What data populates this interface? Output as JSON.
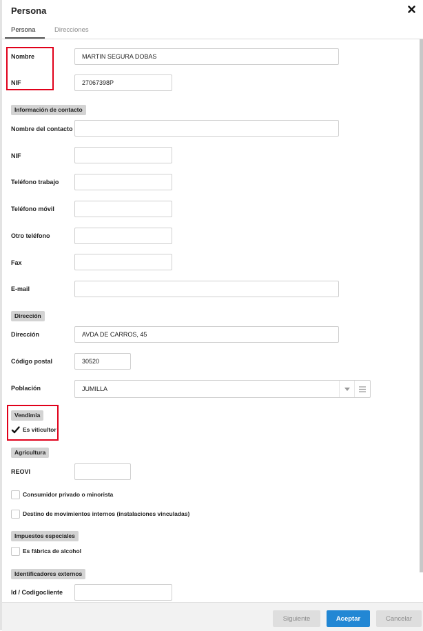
{
  "dialog": {
    "title": "Persona",
    "tabs": [
      {
        "label": "Persona",
        "active": true
      },
      {
        "label": "Direcciones",
        "active": false
      }
    ]
  },
  "main": {
    "nombre": {
      "label": "Nombre",
      "value": "MARTIN SEGURA DOBAS"
    },
    "nif": {
      "label": "NIF",
      "value": "27067398P"
    }
  },
  "contacto": {
    "section": "Información de contacto",
    "nombre_contacto": {
      "label": "Nombre del contacto",
      "value": ""
    },
    "nif": {
      "label": "NIF",
      "value": ""
    },
    "telefono_trabajo": {
      "label": "Teléfono trabajo",
      "value": ""
    },
    "telefono_movil": {
      "label": "Teléfono móvil",
      "value": ""
    },
    "otro_telefono": {
      "label": "Otro teléfono",
      "value": ""
    },
    "fax": {
      "label": "Fax",
      "value": ""
    },
    "email": {
      "label": "E-mail",
      "value": ""
    }
  },
  "direccion": {
    "section": "Dirección",
    "direccion": {
      "label": "Dirección",
      "value": "AVDA DE CARROS, 45"
    },
    "codigo_postal": {
      "label": "Código postal",
      "value": "30520"
    },
    "poblacion": {
      "label": "Población",
      "value": "JUMILLA"
    }
  },
  "vendimia": {
    "section": "Vendimia",
    "viticultor": {
      "label": "Es viticultor",
      "checked": true
    }
  },
  "agricultura": {
    "section": "Agricultura",
    "reovi": {
      "label": "REOVI",
      "value": ""
    },
    "consumidor": {
      "label": "Consumidor privado o minorista",
      "checked": false
    },
    "destino": {
      "label": "Destino de movimientos internos (instalaciones vinculadas)",
      "checked": false
    }
  },
  "impuestos": {
    "section": "Impuestos especiales",
    "fabrica": {
      "label": "Es fábrica de alcohol",
      "checked": false
    }
  },
  "identificadores": {
    "section": "Identificadores externos",
    "codigo_cliente": {
      "label": "Id / Codigocliente",
      "value": ""
    }
  },
  "footer": {
    "siguiente": "Siguiente",
    "aceptar": "Aceptar",
    "cancelar": "Cancelar"
  },
  "colors": {
    "accent": "#2287d4",
    "highlight": "#e0001a",
    "section_bg": "#d3d3d3"
  }
}
